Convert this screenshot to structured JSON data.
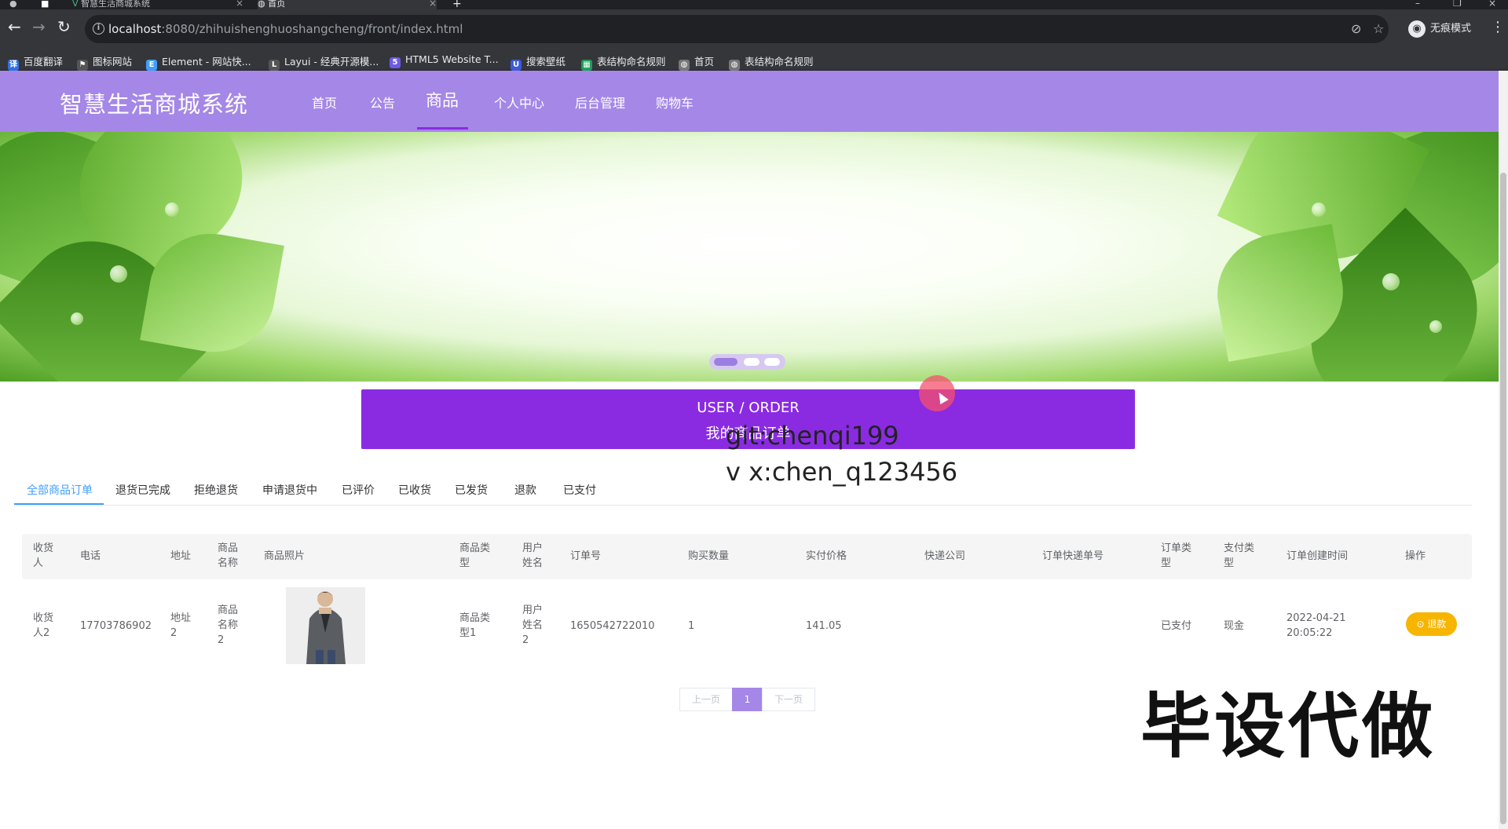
{
  "browser": {
    "tabs": [
      {
        "title": "智慧生活商城系统",
        "active": false
      },
      {
        "title": "首页",
        "active": true
      }
    ],
    "new_tab_icon": "plus-icon",
    "url_host": "localhost",
    "url_rest": ":8080/zhihuishenghuoshangcheng/front/index.html",
    "incognito_label": "无痕模式",
    "bookmarks": [
      {
        "label": "百度翻译",
        "icon": "translate-icon",
        "color": "#2f6fe4"
      },
      {
        "label": "图标网站",
        "icon": "flag-icon",
        "color": "#555555"
      },
      {
        "label": "Element - 网站快...",
        "icon": "element-icon",
        "color": "#409eff"
      },
      {
        "label": "Layui - 经典开源模...",
        "icon": "layui-icon",
        "color": "#555555"
      },
      {
        "label": "HTML5 Website T...",
        "icon": "html5-icon",
        "color": "#6b5ce7"
      },
      {
        "label": "搜索壁纸",
        "icon": "wallpaper-icon",
        "color": "#3b5bdb"
      },
      {
        "label": "表结构命名规则",
        "icon": "sheet-icon",
        "color": "#1e9e5a"
      },
      {
        "label": "首页",
        "icon": "globe-icon",
        "color": "#777777"
      },
      {
        "label": "表结构命名规则",
        "icon": "globe-icon",
        "color": "#777777"
      }
    ]
  },
  "site": {
    "brand": "智慧生活商城系统",
    "nav": [
      {
        "label": "首页",
        "active": false
      },
      {
        "label": "公告",
        "active": false
      },
      {
        "label": "商品",
        "active": true
      },
      {
        "label": "个人中心",
        "active": false
      },
      {
        "label": "后台管理",
        "active": false
      },
      {
        "label": "购物车",
        "active": false
      }
    ],
    "header_color": "#a587e7",
    "accent_color": "#8a2be2"
  },
  "carousel": {
    "slide_count": 3,
    "active_index": 0
  },
  "order_section": {
    "title_en": "USER / ORDER",
    "title_cn": "我的商品订单"
  },
  "order_tabs": [
    {
      "label": "全部商品订单",
      "active": true
    },
    {
      "label": "退货已完成",
      "active": false
    },
    {
      "label": "拒绝退货",
      "active": false
    },
    {
      "label": "申请退货中",
      "active": false
    },
    {
      "label": "已评价",
      "active": false
    },
    {
      "label": "已收货",
      "active": false
    },
    {
      "label": "已发货",
      "active": false
    },
    {
      "label": "退款",
      "active": false
    },
    {
      "label": "已支付",
      "active": false
    }
  ],
  "table": {
    "headers": {
      "consignee": "收货人",
      "phone": "电话",
      "address": "地址",
      "product_name": "商品名称",
      "product_photo": "商品照片",
      "product_type": "商品类型",
      "username": "用户姓名",
      "order_no": "订单号",
      "quantity": "购买数量",
      "paid_price": "实付价格",
      "courier": "快递公司",
      "tracking_no": "订单快递单号",
      "order_type": "订单类型",
      "pay_type": "支付类型",
      "created_at": "订单创建时间",
      "actions": "操作"
    },
    "rows": [
      {
        "consignee": "收货人2",
        "phone": "17703786902",
        "address": "地址2",
        "product_name": "商品名称2",
        "product_type": "商品类型1",
        "username": "用户姓名2",
        "order_no": "1650542722010",
        "quantity": "1",
        "paid_price": "141.05",
        "courier": "",
        "tracking_no": "",
        "order_type": "已支付",
        "pay_type": "现金",
        "created_date": "2022-04-21",
        "created_time": "20:05:22",
        "action_label": "退款",
        "action_icon": "refund-icon"
      }
    ]
  },
  "pagination": {
    "prev_label": "上一页",
    "current_page": "1",
    "next_label": "下一页"
  },
  "overlays": {
    "git_line": "git:chenqi199",
    "wx_line": "v x:chen_q123456",
    "watermark": "毕设代做"
  }
}
